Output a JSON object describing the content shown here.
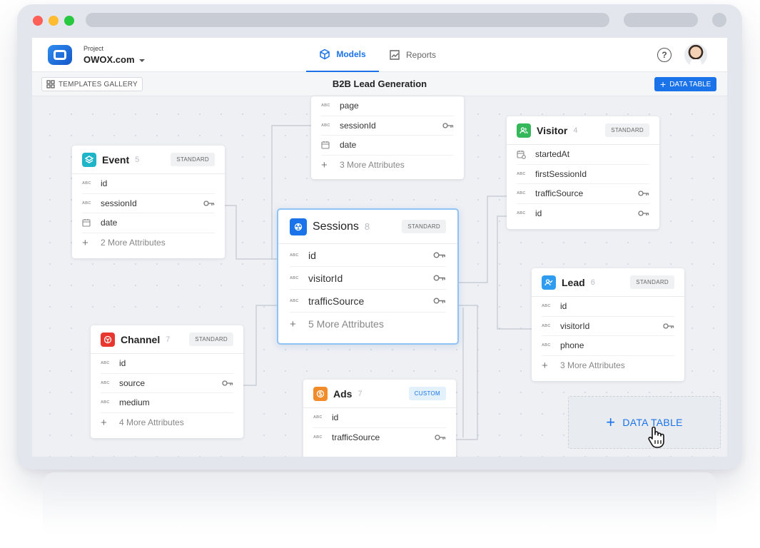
{
  "header": {
    "project_label": "Project",
    "project_name": "OWOX.com",
    "tabs": [
      {
        "label": "Models",
        "icon": "cube-icon",
        "active": true
      },
      {
        "label": "Reports",
        "icon": "chart-icon",
        "active": false
      }
    ],
    "help_icon": "?"
  },
  "toolbar": {
    "templates_label": "TEMPLATES GALLERY",
    "title": "B2B Lead Generation",
    "add_table_label": "DATA TABLE"
  },
  "colors": {
    "accent": "#1a73e8",
    "event": "#1fb5c9",
    "visitor": "#34b85a",
    "sessions": "#1a73e8",
    "lead": "#2f9cf0",
    "channel": "#e8372e",
    "ads": "#f28b2a"
  },
  "cards": {
    "pages": {
      "rows": [
        {
          "type": "ABC",
          "label": "page",
          "key": false
        },
        {
          "type": "ABC",
          "label": "sessionId",
          "key": true
        },
        {
          "type": "date",
          "label": "date",
          "key": false
        }
      ],
      "more": "3 More Attributes"
    },
    "event": {
      "title": "Event",
      "count": "5",
      "badge": "STANDARD",
      "rows": [
        {
          "type": "ABC",
          "label": "id",
          "key": false
        },
        {
          "type": "ABC",
          "label": "sessionId",
          "key": true
        },
        {
          "type": "date",
          "label": "date",
          "key": false
        }
      ],
      "more": "2 More Attributes"
    },
    "visitor": {
      "title": "Visitor",
      "count": "4",
      "badge": "STANDARD",
      "rows": [
        {
          "type": "date",
          "label": "startedAt",
          "key": false
        },
        {
          "type": "ABC",
          "label": "firstSessionId",
          "key": false
        },
        {
          "type": "ABC",
          "label": "trafficSource",
          "key": true
        },
        {
          "type": "ABC",
          "label": "id",
          "key": true
        }
      ]
    },
    "sessions": {
      "title": "Sessions",
      "count": "8",
      "badge": "STANDARD",
      "rows": [
        {
          "type": "ABC",
          "label": "id",
          "key": true
        },
        {
          "type": "ABC",
          "label": "visitorId",
          "key": true
        },
        {
          "type": "ABC",
          "label": "trafficSource",
          "key": true
        }
      ],
      "more": "5 More Attributes"
    },
    "lead": {
      "title": "Lead",
      "count": "6",
      "badge": "STANDARD",
      "rows": [
        {
          "type": "ABC",
          "label": "id",
          "key": false
        },
        {
          "type": "ABC",
          "label": "visitorId",
          "key": true
        },
        {
          "type": "ABC",
          "label": "phone",
          "key": false
        }
      ],
      "more": "3 More Attributes"
    },
    "channel": {
      "title": "Channel",
      "count": "7",
      "badge": "STANDARD",
      "rows": [
        {
          "type": "ABC",
          "label": "id",
          "key": false
        },
        {
          "type": "ABC",
          "label": "source",
          "key": true
        },
        {
          "type": "ABC",
          "label": "medium",
          "key": false
        }
      ],
      "more": "4 More Attributes"
    },
    "ads": {
      "title": "Ads",
      "count": "7",
      "badge": "CUSTOM",
      "rows": [
        {
          "type": "ABC",
          "label": "id",
          "key": false
        },
        {
          "type": "ABC",
          "label": "trafficSource",
          "key": true
        }
      ]
    }
  },
  "placeholder": {
    "label": "DATA TABLE"
  }
}
